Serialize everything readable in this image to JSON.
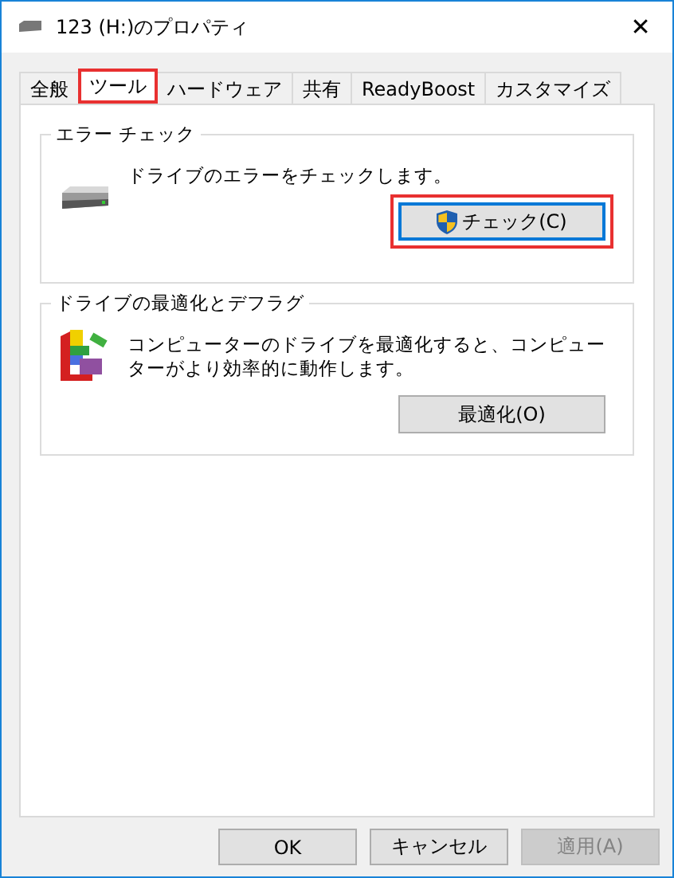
{
  "window": {
    "title": "123 (H:)のプロパティ",
    "close": "✕"
  },
  "tabs": [
    {
      "label": "全般",
      "selected": false,
      "highlighted": false
    },
    {
      "label": "ツール",
      "selected": true,
      "highlighted": true
    },
    {
      "label": "ハードウェア",
      "selected": false,
      "highlighted": false
    },
    {
      "label": "共有",
      "selected": false,
      "highlighted": false
    },
    {
      "label": "ReadyBoost",
      "selected": false,
      "highlighted": false
    },
    {
      "label": "カスタマイズ",
      "selected": false,
      "highlighted": false
    }
  ],
  "groups": [
    {
      "title": "エラー チェック",
      "kind": "drive",
      "description": "ドライブのエラーをチェックします。",
      "button": {
        "label": "チェック(C)",
        "shield": true,
        "focused": true,
        "highlighted": true
      }
    },
    {
      "title": "ドライブの最適化とデフラグ",
      "kind": "defrag",
      "description": "コンピューターのドライブを最適化すると、コンピューターがより効率的に動作します。",
      "button": {
        "label": "最適化(O)",
        "shield": false,
        "focused": false,
        "highlighted": false
      }
    }
  ],
  "buttons": [
    {
      "label": "OK",
      "disabled": false
    },
    {
      "label": "キャンセル",
      "disabled": false
    },
    {
      "label": "適用(A)",
      "disabled": true
    }
  ]
}
